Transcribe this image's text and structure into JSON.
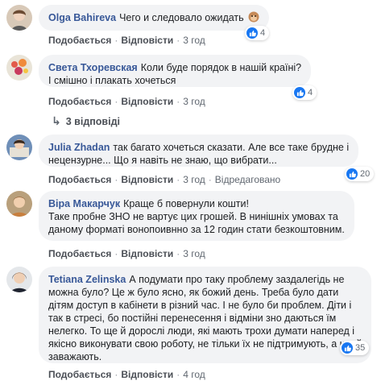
{
  "comments": [
    {
      "author": "Olga Bahireva",
      "text": "Чего и следовало ожидать",
      "emoji": "monkey-face-emoji",
      "like_label": "Подобається",
      "reply_label": "Відповісти",
      "time": "3 год",
      "reactions": "4"
    },
    {
      "author": "Света Тхоревская",
      "text": "Коли буде порядок в нашій країні?\nІ смішно і плакать хочеться",
      "like_label": "Подобається",
      "reply_label": "Відповісти",
      "time": "3 год",
      "reactions": "4",
      "replies_label": "3 відповіді"
    },
    {
      "author": "Julia Zhadan",
      "text": "так багато хочеться сказати. Але все таке брудне і\nнецензурне... Що я навіть не знаю, що вибрати...",
      "like_label": "Подобається",
      "reply_label": "Відповісти",
      "time": "3 год",
      "edited_label": "Відредаговано",
      "reactions": "20"
    },
    {
      "author": "Віра Макарчук",
      "text": "Краще б повернули кошти!\nТаке пробне ЗНО не вартує цих грошей. В нинішніх умовах та\nданому форматі вонопоивнно за 12 годин стати безкоштовним.",
      "like_label": "Подобається",
      "reply_label": "Відповісти",
      "time": "3 год"
    },
    {
      "author": "Tetiana Zelinska",
      "text": "А подумати про таку проблему заздалегідь не\nможна було? Це ж було ясно, як божий день. Треба було дати\nдітям доступ в кабінети в різний час. І не було би проблем. Діти і\nтак в стресі, бо постійні перенесення і відміни зно даються їм\nнелегко. То ще й дорослі люди, які мають трохи думати наперед і\nякісно виконувати свою роботу, не тільки їх не підтримують, а ще й\nзаважають.",
      "like_label": "Подобається",
      "reply_label": "Відповісти",
      "time": "4 год",
      "reactions": "35"
    }
  ],
  "colors": {
    "author": "#385898",
    "bubble": "#f2f3f5",
    "like": "#1877f2",
    "meta": "#606770"
  }
}
